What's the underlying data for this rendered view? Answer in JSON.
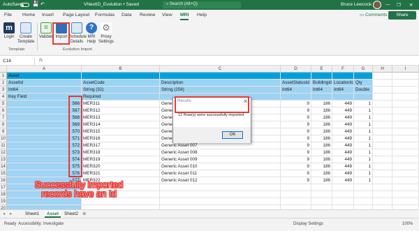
{
  "titlebar": {
    "autosave": "AutoSave",
    "doc_title": "VNextID_Evolution • Saved",
    "search_placeholder": "Search (Alt+Q)",
    "user": "Bruce Lewcock",
    "window_controls": [
      "—",
      "❐",
      "✕"
    ]
  },
  "menu": {
    "tabs": [
      "File",
      "Home",
      "Insert",
      "Page Layout",
      "Formulas",
      "Data",
      "Review",
      "View",
      "MRI",
      "Help"
    ],
    "active": "MRI",
    "comments": "Comments",
    "share": "Share"
  },
  "ribbon": {
    "buttons": [
      {
        "label": "Login",
        "icon": "login-icon",
        "color": "#1e3a5f"
      },
      {
        "label": "Create\nTemplate",
        "icon": "create-template-icon",
        "color": "#5b8fc7"
      },
      {
        "label": "Validate",
        "icon": "validate-icon",
        "color": "#3f9a3f"
      },
      {
        "label": "Import",
        "icon": "import-icon",
        "color": "#2f6fb5"
      },
      {
        "label": "Schedule\nDetails",
        "icon": "schedule-icon",
        "color": "#4a7fbf"
      },
      {
        "label": "MRI\nHelp",
        "icon": "help-icon",
        "color": "#2e74c9"
      },
      {
        "label": "Proxy\nSettings",
        "icon": "proxy-settings-icon",
        "color": "#777777"
      }
    ],
    "groups": [
      "Template",
      "Evolution Import"
    ]
  },
  "formula_bar": {
    "name_box": "C18",
    "fx": "fx"
  },
  "columns": [
    "A",
    "B",
    "C",
    "D",
    "E",
    "F",
    "G",
    "H",
    "I"
  ],
  "header_rows": [
    {
      "A": "Asset",
      "B": "",
      "C": "",
      "D": "",
      "E": "",
      "F": "",
      "G": ""
    },
    {
      "A": "AssetId",
      "B": "AssetCode",
      "C": "Description",
      "D": "AssetStatusId",
      "E": "BuildingId",
      "F": "LocationId",
      "G": "Qty"
    },
    {
      "A": "Int64",
      "B": "String (32)",
      "C": "String (256)",
      "D": "Int64",
      "E": "Int64",
      "F": "Int64",
      "G": "Double"
    },
    {
      "A": "Key Field",
      "B": "Required",
      "C": "",
      "D": "",
      "E": "",
      "F": "",
      "G": ""
    }
  ],
  "data_rows": [
    {
      "id": "566",
      "code": "MER311",
      "desc": "Generic Asset 001",
      "status": "9",
      "bld": "186",
      "loc": "449",
      "qty": "1"
    },
    {
      "id": "567",
      "code": "MER312",
      "desc": "Generic Asset 002",
      "status": "9",
      "bld": "186",
      "loc": "449",
      "qty": "1"
    },
    {
      "id": "568",
      "code": "MER313",
      "desc": "Generic Asset 003",
      "status": "9",
      "bld": "186",
      "loc": "449",
      "qty": "1"
    },
    {
      "id": "569",
      "code": "MER314",
      "desc": "Generic Asset 004",
      "status": "9",
      "bld": "186",
      "loc": "449",
      "qty": "1"
    },
    {
      "id": "570",
      "code": "MER315",
      "desc": "Generic Asset 005",
      "status": "9",
      "bld": "186",
      "loc": "449",
      "qty": "1"
    },
    {
      "id": "571",
      "code": "MER316",
      "desc": "Generic Asset 006",
      "status": "9",
      "bld": "186",
      "loc": "449",
      "qty": "1"
    },
    {
      "id": "572",
      "code": "MER317",
      "desc": "Generic Asset 007",
      "status": "9",
      "bld": "186",
      "loc": "449",
      "qty": "1"
    },
    {
      "id": "573",
      "code": "MER318",
      "desc": "Generic Asset 008",
      "status": "9",
      "bld": "186",
      "loc": "449",
      "qty": "1"
    },
    {
      "id": "574",
      "code": "MER319",
      "desc": "Generic Asset 009",
      "status": "9",
      "bld": "186",
      "loc": "449",
      "qty": "1"
    },
    {
      "id": "575",
      "code": "MER320",
      "desc": "Generic Asset 010",
      "status": "9",
      "bld": "186",
      "loc": "449",
      "qty": "1"
    },
    {
      "id": "576",
      "code": "MER321",
      "desc": "Generic Asset 011",
      "status": "9",
      "bld": "186",
      "loc": "449",
      "qty": "1"
    },
    {
      "id": "577",
      "code": "MER322",
      "desc": "Generic Asset 012",
      "status": "9",
      "bld": "186",
      "loc": "449",
      "qty": "1"
    }
  ],
  "row_numbers": [
    "1",
    "2",
    "3",
    "4",
    "5",
    "6",
    "7",
    "8",
    "9",
    "10",
    "11",
    "12",
    "13",
    "14",
    "15",
    "16",
    "17",
    "18",
    "19",
    "20"
  ],
  "dialog": {
    "title": "Results",
    "message": "12 Row(s) were successfully imported",
    "ok": "OK",
    "close": "✕"
  },
  "annotation": "Successfully imported records have an Id",
  "sheets": [
    "Sheet1",
    "Asset",
    "Sheet2"
  ],
  "active_sheet": "Asset",
  "status": {
    "ready": "Ready",
    "accessibility": "Accessibility: Investigate",
    "display": "Display Settings",
    "zoom": "100%"
  },
  "colors": {
    "excel_green": "#217346",
    "header_blue": "#00a0dc",
    "field_blue": "#9dd3f2",
    "highlight_red": "#e53935"
  }
}
